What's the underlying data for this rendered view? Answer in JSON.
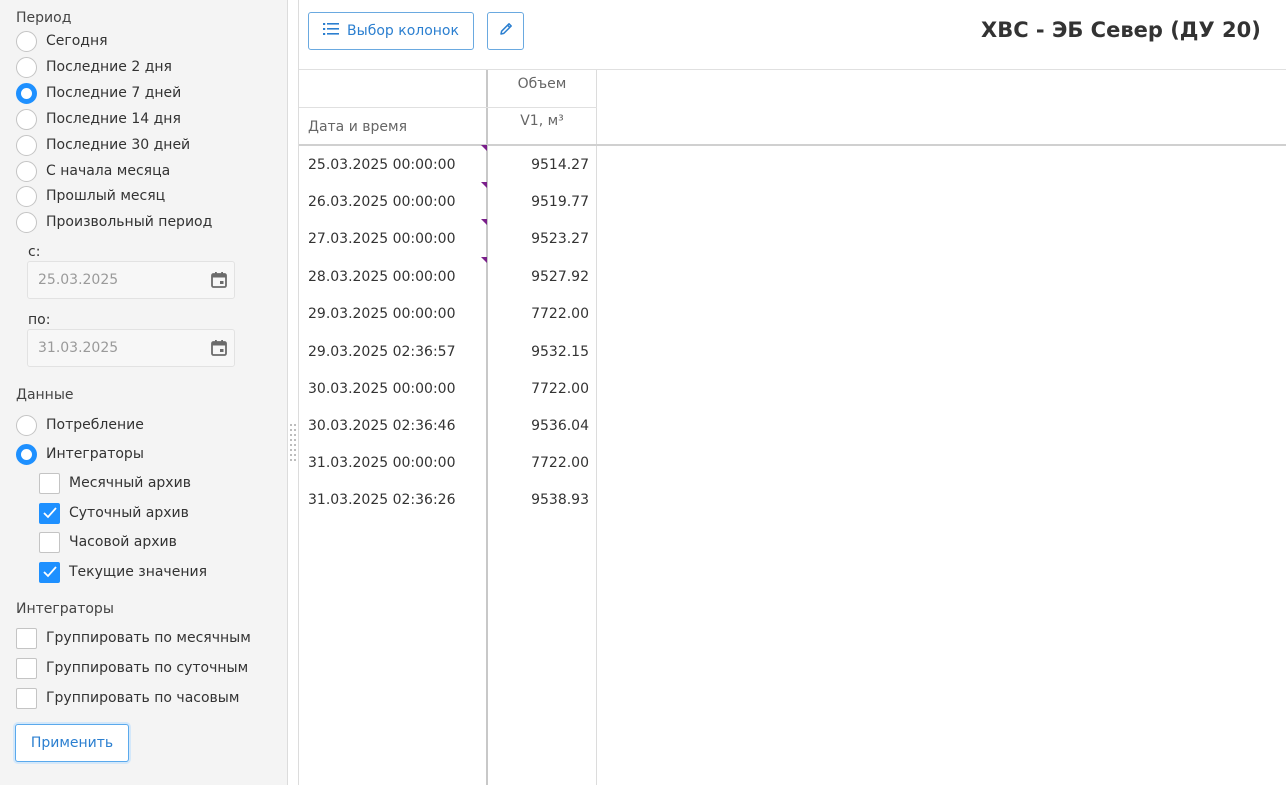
{
  "sidebar": {
    "period_title": "Период",
    "period_options": [
      {
        "label": "Сегодня",
        "selected": false
      },
      {
        "label": "Последние 2 дня",
        "selected": false
      },
      {
        "label": "Последние 7 дней",
        "selected": true
      },
      {
        "label": "Последние 14 дня",
        "selected": false
      },
      {
        "label": "Последние 30 дней",
        "selected": false
      },
      {
        "label": "С начала месяца",
        "selected": false
      },
      {
        "label": "Прошлый месяц",
        "selected": false
      },
      {
        "label": "Произвольный период",
        "selected": false
      }
    ],
    "from_label": "с:",
    "from_value": "25.03.2025",
    "to_label": "по:",
    "to_value": "31.03.2025",
    "data_title": "Данные",
    "data_options": [
      {
        "label": "Потребление",
        "selected": false
      },
      {
        "label": "Интеграторы",
        "selected": true
      }
    ],
    "archive_options": [
      {
        "label": "Месячный архив",
        "checked": false
      },
      {
        "label": "Суточный архив",
        "checked": true
      },
      {
        "label": "Часовой архив",
        "checked": false
      },
      {
        "label": "Текущие значения",
        "checked": true
      }
    ],
    "integrators_title": "Интеграторы",
    "group_options": [
      {
        "label": "Группировать по месячным",
        "checked": false
      },
      {
        "label": "Группировать по суточным",
        "checked": false
      },
      {
        "label": "Группировать по часовым",
        "checked": false
      }
    ],
    "apply_label": "Применить"
  },
  "toolbar": {
    "columns_label": "Выбор колонок",
    "title": "ХВС - ЭБ Север (ДУ 20)"
  },
  "table": {
    "group_header": "Объем",
    "col_datetime": "Дата и время",
    "col_v1": "V1, м³",
    "rows": [
      {
        "datetime": "25.03.2025 00:00:00",
        "v1": "9514.27",
        "marked": true
      },
      {
        "datetime": "26.03.2025 00:00:00",
        "v1": "9519.77",
        "marked": true
      },
      {
        "datetime": "27.03.2025 00:00:00",
        "v1": "9523.27",
        "marked": true
      },
      {
        "datetime": "28.03.2025 00:00:00",
        "v1": "9527.92",
        "marked": true
      },
      {
        "datetime": "29.03.2025 00:00:00",
        "v1": "7722.00",
        "marked": false
      },
      {
        "datetime": "29.03.2025 02:36:57",
        "v1": "9532.15",
        "marked": false
      },
      {
        "datetime": "30.03.2025 00:00:00",
        "v1": "7722.00",
        "marked": false
      },
      {
        "datetime": "30.03.2025 02:36:46",
        "v1": "9536.04",
        "marked": false
      },
      {
        "datetime": "31.03.2025 00:00:00",
        "v1": "7722.00",
        "marked": false
      },
      {
        "datetime": "31.03.2025 02:36:26",
        "v1": "9538.93",
        "marked": false
      }
    ]
  },
  "colors": {
    "accent": "#1e90ff",
    "marker": "#7a1f8a"
  }
}
